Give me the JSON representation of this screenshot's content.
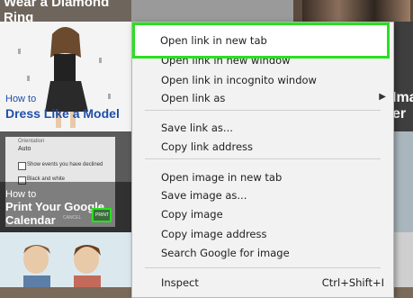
{
  "tiles": {
    "top_left_title": "Wear a Diamond Ring",
    "dress_how_to": "How to",
    "dress_title": "Dress Like a Model",
    "calendar_panel": {
      "orientation_label": "Orientation",
      "orientation_value": "Auto",
      "checkbox_declined": "Show events you have declined",
      "checkbox_bw": "Black and white",
      "cancel": "CANCEL",
      "print": "PRINT"
    },
    "calendar_how_to": "How to",
    "calendar_title": "Print Your Google Calendar",
    "right_partial_1": "Ima",
    "right_partial_2": "er"
  },
  "menu": {
    "items": [
      {
        "label": "Open link in new tab"
      },
      {
        "label": "Open link in new window"
      },
      {
        "label": "Open link in incognito window"
      },
      {
        "label": "Open link as",
        "submenu": true
      },
      {
        "label": "Save link as..."
      },
      {
        "label": "Copy link address"
      },
      {
        "label": "Open image in new tab"
      },
      {
        "label": "Save image as..."
      },
      {
        "label": "Copy image"
      },
      {
        "label": "Copy image address"
      },
      {
        "label": "Search Google for image"
      },
      {
        "label": "Inspect",
        "shortcut": "Ctrl+Shift+I"
      }
    ],
    "submenu_glyph": "▶"
  },
  "colors": {
    "highlight": "#29e020",
    "menu_bg": "#f2f2f2",
    "tile_title_blue": "#1f4fa8"
  }
}
